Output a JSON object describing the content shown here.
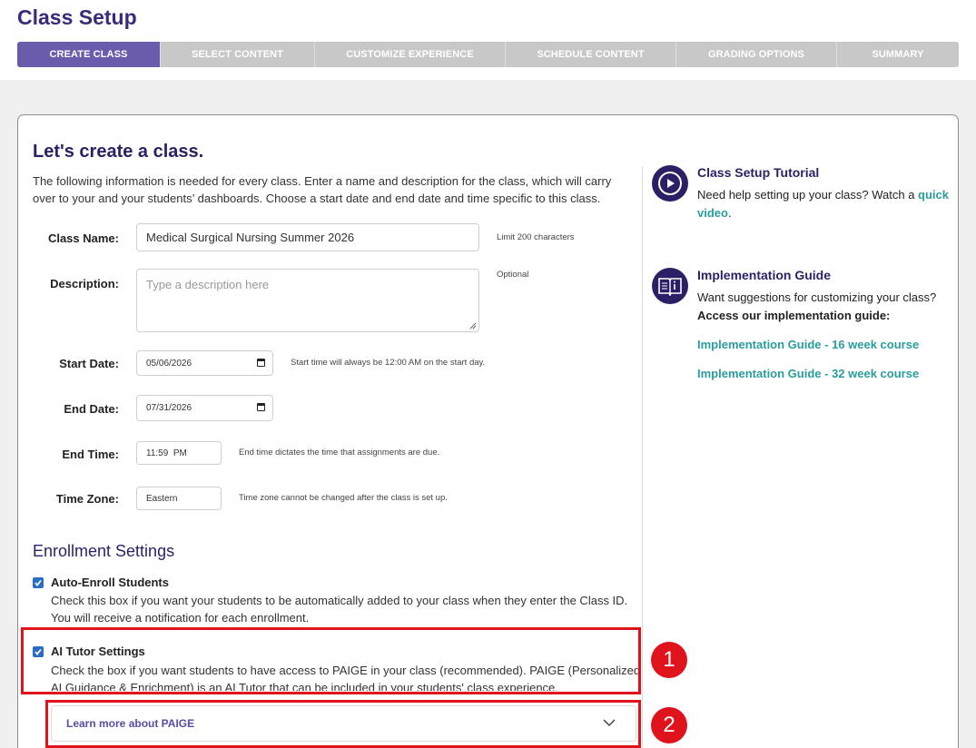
{
  "header": {
    "title": "Class Setup",
    "steps": [
      {
        "label": "CREATE CLASS"
      },
      {
        "label": "SELECT CONTENT"
      },
      {
        "label": "CUSTOMIZE EXPERIENCE"
      },
      {
        "label": "SCHEDULE CONTENT"
      },
      {
        "label": "GRADING OPTIONS"
      },
      {
        "label": "SUMMARY"
      }
    ],
    "active_step": 0
  },
  "form": {
    "heading": "Let's create a class.",
    "intro": "The following information is needed for every class. Enter a name and description for the class, which will carry over to your and your students’ dashboards. Choose a start date and end date and time specific to this class.",
    "class_name": {
      "label": "Class Name:",
      "value": "Medical Surgical Nursing Summer 2026",
      "hint": "Limit 200 characters"
    },
    "description": {
      "label": "Description:",
      "placeholder": "Type a description here",
      "hint": "Optional"
    },
    "start_date": {
      "label": "Start Date:",
      "value": "05/06/2026",
      "hint": "Start time will always be 12:00 AM on the start day."
    },
    "end_date": {
      "label": "End Date:",
      "value": "07/31/2026"
    },
    "end_time": {
      "label": "End Time:",
      "value": "11:59  PM",
      "hint": "End time dictates the time that assignments are due."
    },
    "time_zone": {
      "label": "Time Zone:",
      "value": "Eastern",
      "hint": "Time zone cannot be changed after the class is set up."
    }
  },
  "enrollment": {
    "title": "Enrollment Settings",
    "auto_enroll": {
      "title": "Auto-Enroll Students",
      "checked": true,
      "desc_line1": "Check this box if you want your students to be automatically added to your class when they enter the Class ID.",
      "desc_line2": "You will receive a notification for each enrollment."
    },
    "ai_tutor": {
      "title": "AI Tutor Settings",
      "checked": true,
      "desc_line1": "Check the box if you want students to have access to PAIGE in your class (recommended). PAIGE (Personalized",
      "desc_line2": "AI Guidance & Enrichment) is an AI Tutor that can be included in your students' class experience."
    },
    "learn_more": "Learn more about PAIGE"
  },
  "sidebar": {
    "tutorial": {
      "title": "Class Setup Tutorial",
      "text_before": "Need help setting up your class? Watch a ",
      "link_part1": "quick",
      "link_part2": "video",
      "text_after": "."
    },
    "guide": {
      "title": "Implementation Guide",
      "text": "Want suggestions for customizing your class?",
      "text_bold": "Access our implementation guide:",
      "links": [
        "Implementation Guide - 16 week course",
        "Implementation Guide - 32 week course"
      ]
    }
  },
  "annotations": {
    "badge1": "1",
    "badge2": "2"
  },
  "colors": {
    "accent": "#6b5bad",
    "heading": "#2d1f66",
    "link": "#2a9d9d",
    "highlight": "#e0121c",
    "checkbox": "#2a6dc2"
  }
}
